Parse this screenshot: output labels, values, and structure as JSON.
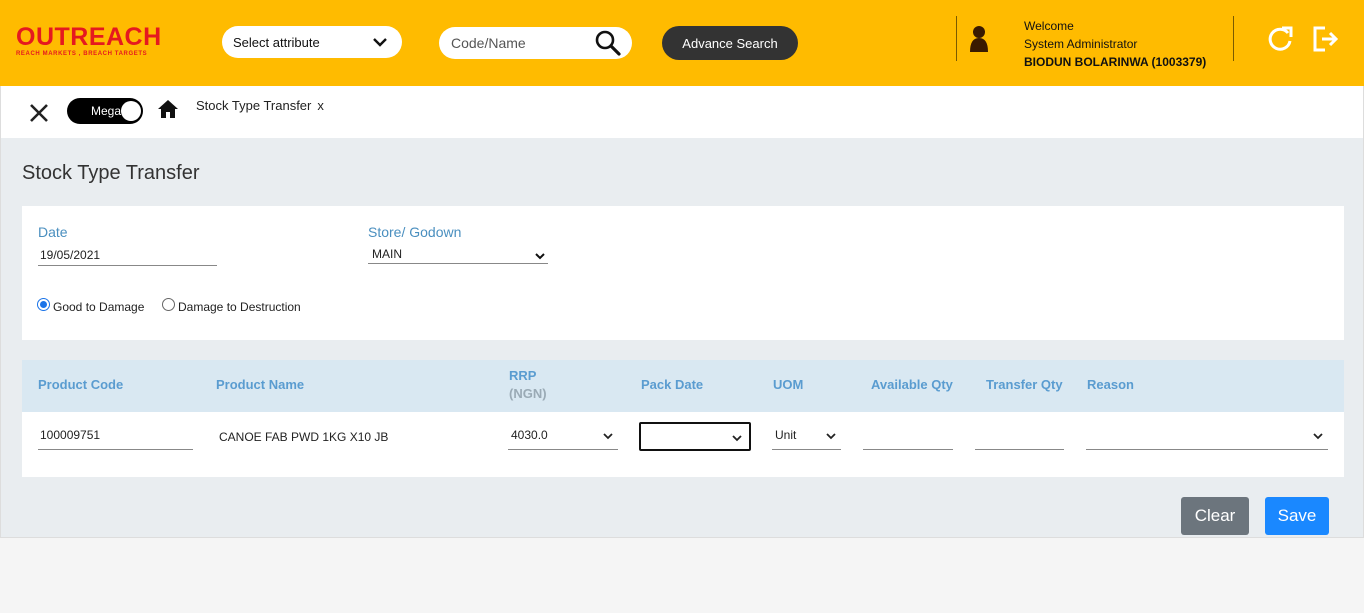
{
  "header": {
    "logo_text": "OUTREACH",
    "logo_tagline": "REACH MARKETS ,  BREACH TARGETS",
    "attribute_select": "Select attribute",
    "search_placeholder": "Code/Name",
    "advance_search_label": "Advance Search",
    "welcome": "Welcome",
    "role": "System Administrator",
    "user": "BIODUN BOLARINWA (1003379)",
    "brand_color": "#ffbb00",
    "icons": [
      "chevron-down-icon",
      "search-icon",
      "user-icon",
      "refresh-icon",
      "logout-icon"
    ]
  },
  "tabbar": {
    "mega_label": "Mega",
    "active_tab": "Stock Type Transfer",
    "tab_close": "x",
    "icons": [
      "close-icon",
      "home-icon"
    ]
  },
  "page": {
    "title": "Stock Type Transfer"
  },
  "form": {
    "date_label": "Date",
    "date_value": "19/05/2021",
    "store_label": "Store/ Godown",
    "store_value": "MAIN",
    "radio_good_to_damage": "Good to Damage",
    "radio_damage_to_destruction": "Damage to Destruction",
    "selected_radio": "Good to Damage"
  },
  "grid": {
    "columns": [
      "Product Code",
      "Product Name",
      "RRP",
      "Pack Date",
      "UOM",
      "Available Qty",
      "Transfer Qty",
      "Reason"
    ],
    "rrp_sub": "(NGN)",
    "rows": [
      {
        "product_code": "100009751",
        "product_name": "CANOE FAB PWD 1KG  X10 JB",
        "rrp": "4030.0",
        "pack_date": "",
        "uom": "Unit",
        "available_qty": "",
        "transfer_qty": "",
        "reason": ""
      }
    ]
  },
  "actions": {
    "clear_label": "Clear",
    "save_label": "Save",
    "clear_color": "#6c757d",
    "save_color": "#1a88ff"
  }
}
